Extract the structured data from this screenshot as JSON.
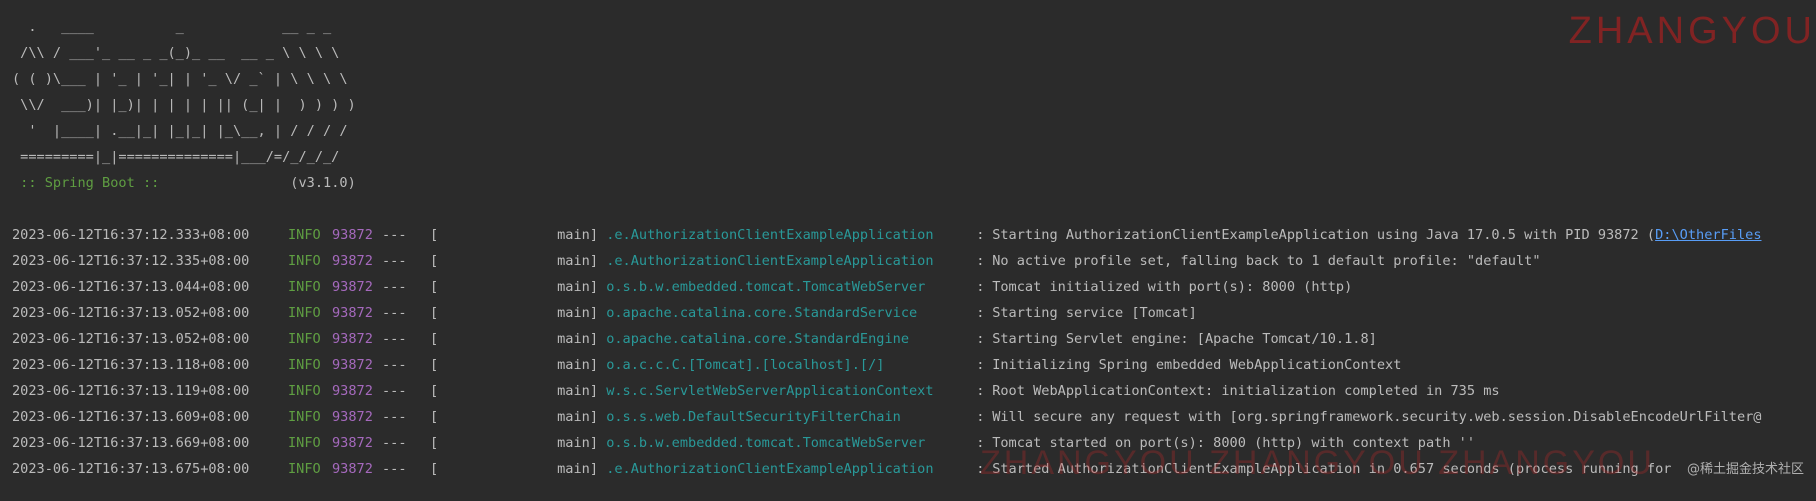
{
  "banner": {
    "lines": [
      "  .   ____          _            __ _ _",
      " /\\\\ / ___'_ __ _ _(_)_ __  __ _ \\ \\ \\ \\",
      "( ( )\\___ | '_ | '_| | '_ \\/ _` | \\ \\ \\ \\",
      " \\\\/  ___)| |_)| | | | | || (_| |  ) ) ) )",
      "  '  |____| .__|_| |_|_| |_\\__, | / / / /",
      " =========|_|==============|___/=/_/_/_/"
    ],
    "spring_label": " :: Spring Boot ::",
    "version": "                (v3.1.0)"
  },
  "log": [
    {
      "ts": "2023-06-12T16:37:12.333+08:00",
      "level": "INFO",
      "pid": "93872",
      "sep": "---",
      "thread": "main]",
      "logger": ".e.AuthorizationClientExampleApplication",
      "msg": "Starting AuthorizationClientExampleApplication using Java 17.0.5 with PID 93872 (",
      "link": "D:\\OtherFiles"
    },
    {
      "ts": "2023-06-12T16:37:12.335+08:00",
      "level": "INFO",
      "pid": "93872",
      "sep": "---",
      "thread": "main]",
      "logger": ".e.AuthorizationClientExampleApplication",
      "msg": "No active profile set, falling back to 1 default profile: \"default\"",
      "link": ""
    },
    {
      "ts": "2023-06-12T16:37:13.044+08:00",
      "level": "INFO",
      "pid": "93872",
      "sep": "---",
      "thread": "main]",
      "logger": "o.s.b.w.embedded.tomcat.TomcatWebServer",
      "msg": "Tomcat initialized with port(s): 8000 (http)",
      "link": ""
    },
    {
      "ts": "2023-06-12T16:37:13.052+08:00",
      "level": "INFO",
      "pid": "93872",
      "sep": "---",
      "thread": "main]",
      "logger": "o.apache.catalina.core.StandardService",
      "msg": "Starting service [Tomcat]",
      "link": ""
    },
    {
      "ts": "2023-06-12T16:37:13.052+08:00",
      "level": "INFO",
      "pid": "93872",
      "sep": "---",
      "thread": "main]",
      "logger": "o.apache.catalina.core.StandardEngine",
      "msg": "Starting Servlet engine: [Apache Tomcat/10.1.8]",
      "link": ""
    },
    {
      "ts": "2023-06-12T16:37:13.118+08:00",
      "level": "INFO",
      "pid": "93872",
      "sep": "---",
      "thread": "main]",
      "logger": "o.a.c.c.C.[Tomcat].[localhost].[/]",
      "msg": "Initializing Spring embedded WebApplicationContext",
      "link": ""
    },
    {
      "ts": "2023-06-12T16:37:13.119+08:00",
      "level": "INFO",
      "pid": "93872",
      "sep": "---",
      "thread": "main]",
      "logger": "w.s.c.ServletWebServerApplicationContext",
      "msg": "Root WebApplicationContext: initialization completed in 735 ms",
      "link": ""
    },
    {
      "ts": "2023-06-12T16:37:13.609+08:00",
      "level": "INFO",
      "pid": "93872",
      "sep": "---",
      "thread": "main]",
      "logger": "o.s.s.web.DefaultSecurityFilterChain",
      "msg": "Will secure any request with [org.springframework.security.web.session.DisableEncodeUrlFilter@",
      "link": ""
    },
    {
      "ts": "2023-06-12T16:37:13.669+08:00",
      "level": "INFO",
      "pid": "93872",
      "sep": "---",
      "thread": "main]",
      "logger": "o.s.b.w.embedded.tomcat.TomcatWebServer",
      "msg": "Tomcat started on port(s): 8000 (http) with context path ''",
      "link": ""
    },
    {
      "ts": "2023-06-12T16:37:13.675+08:00",
      "level": "INFO",
      "pid": "93872",
      "sep": "---",
      "thread": "main]",
      "logger": ".e.AuthorizationClientExampleApplication",
      "msg": "Started AuthorizationClientExampleApplication in 0.657 seconds (process running for",
      "link": ""
    }
  ],
  "watermarks": {
    "top": "ZHANGYOU",
    "bottom": "ZHANGYOU ZHANGYOU ZHANGYOU",
    "corner": "@稀土掘金技术社区"
  },
  "colors": {
    "background": "#2b2b2b",
    "text": "#bbbbbb",
    "info": "#5f9e42",
    "pid": "#a569bd",
    "logger": "#299999",
    "link": "#589df6"
  }
}
